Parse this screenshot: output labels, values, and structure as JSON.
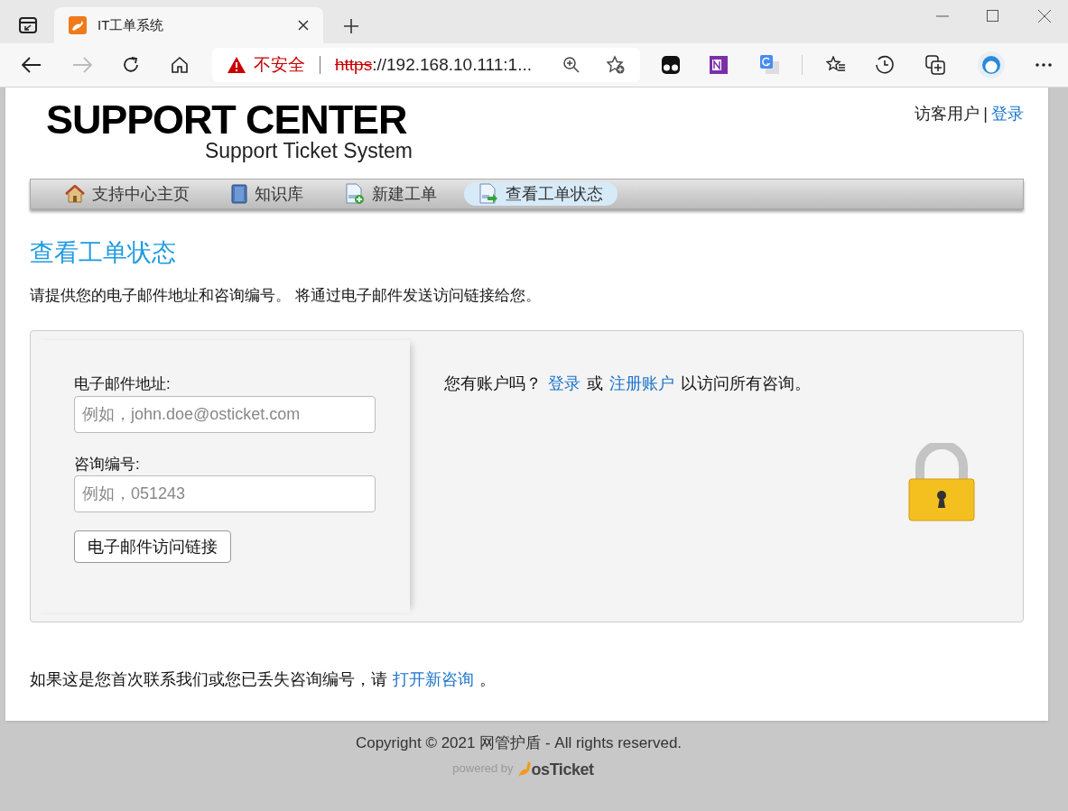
{
  "browser": {
    "tab_title": "IT工单系统",
    "address": {
      "warning": "不安全",
      "scheme": "https",
      "rest": "://192.168.10.111:1..."
    }
  },
  "header": {
    "logo_title": "SUPPORT CENTER",
    "logo_subtitle": "Support Ticket System",
    "user_label": "访客用户",
    "separator": "|",
    "login_link": "登录"
  },
  "nav": {
    "items": [
      {
        "label": "支持中心主页",
        "kind": "home",
        "selected": false
      },
      {
        "label": "知识库",
        "kind": "book",
        "selected": false
      },
      {
        "label": "新建工单",
        "kind": "new",
        "selected": false
      },
      {
        "label": "查看工单状态",
        "kind": "status",
        "selected": true
      }
    ]
  },
  "page": {
    "title": "查看工单状态",
    "intro": "请提供您的电子邮件地址和咨询编号。 将通过电子邮件发送访问链接给您。"
  },
  "form": {
    "email_label": "电子邮件地址:",
    "email_placeholder": "例如，john.doe@osticket.com",
    "ticket_label": "咨询编号:",
    "ticket_placeholder": "例如，051243",
    "submit": "电子邮件访问链接"
  },
  "account": {
    "prefix": "您有账户吗？",
    "login": "登录",
    "or": "或",
    "register": "注册账户",
    "suffix": "以访问所有咨询。"
  },
  "footer_note": {
    "prefix": "如果这是您首次联系我们或您已丢失咨询编号，请",
    "link": "打开新咨询",
    "suffix": "。"
  },
  "footer": {
    "copyright": "Copyright © 2021 网管护盾 - All rights reserved.",
    "powered_by": "powered by",
    "brand": "osTicket"
  }
}
